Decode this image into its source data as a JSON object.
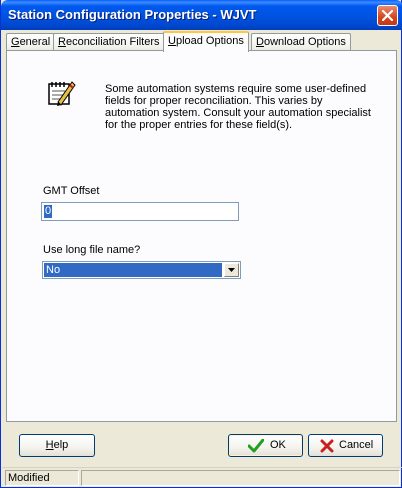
{
  "window": {
    "title": "Station Configuration Properties - WJVT",
    "close_icon": "close-icon"
  },
  "tabs": [
    {
      "label_pre": "",
      "label_u": "G",
      "label_post": "eneral",
      "active": false
    },
    {
      "label_pre": "",
      "label_u": "R",
      "label_post": "econciliation Filters",
      "active": false
    },
    {
      "label_pre": "",
      "label_u": "U",
      "label_post": "pload Options",
      "active": true
    },
    {
      "label_pre": "",
      "label_u": "D",
      "label_post": "ownload Options",
      "active": false
    }
  ],
  "panel": {
    "note_icon": "notepad-pencil-icon",
    "note_text": "Some automation systems require some user-defined fields for proper reconciliation.  This varies by automation system.  Consult your automation specialist for the proper entries for these field(s).",
    "gmt_label": "GMT Offset",
    "gmt_value": "0",
    "long_name_label": "Use long file name?",
    "long_name_value": "No"
  },
  "buttons": {
    "help_u": "H",
    "help_rest": "elp",
    "ok_label": "OK",
    "cancel_label": "Cancel",
    "ok_icon": "checkmark-icon",
    "cancel_icon": "x-icon"
  },
  "status": {
    "text": "Modified"
  },
  "colors": {
    "titlebar": "#0054E3",
    "selection": "#316AC5",
    "active_tab_accent": "#FFC83C",
    "ok_check": "#21A121",
    "cancel_x": "#C8201E"
  }
}
